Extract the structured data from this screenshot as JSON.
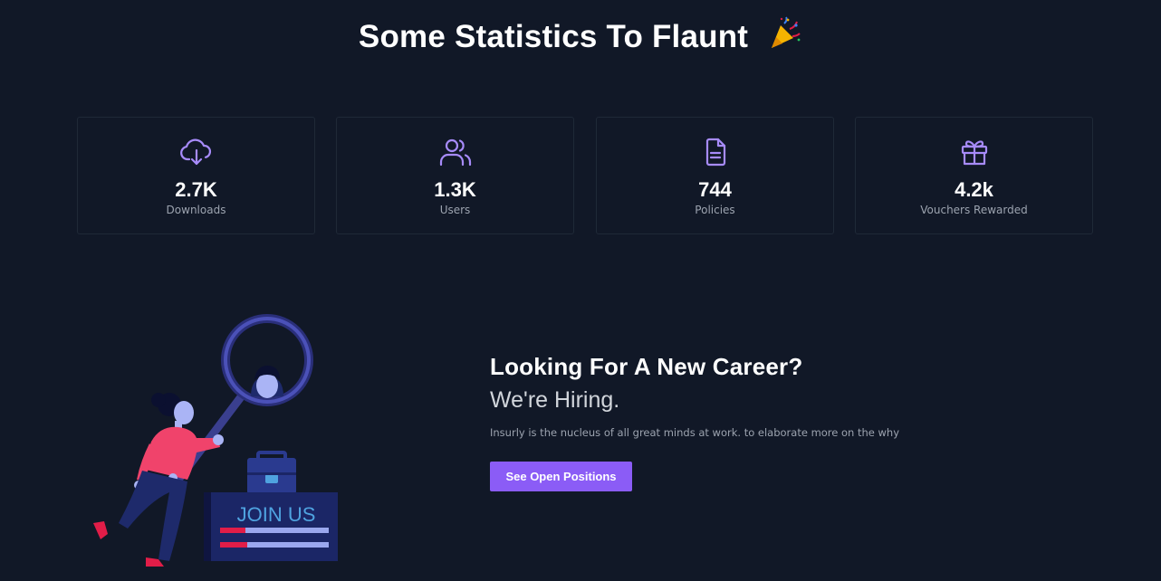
{
  "header": {
    "title": "Some Statistics To Flaunt",
    "emoji": "party-popper-icon"
  },
  "stats": [
    {
      "icon": "cloud-download-icon",
      "value": "2.7K",
      "label": "Downloads"
    },
    {
      "icon": "users-icon",
      "value": "1.3K",
      "label": "Users"
    },
    {
      "icon": "document-icon",
      "value": "744",
      "label": "Policies"
    },
    {
      "icon": "gift-icon",
      "value": "4.2k",
      "label": "Vouchers Rewarded"
    }
  ],
  "career": {
    "heading": "Looking For A New Career?",
    "subheading": "We're Hiring.",
    "description": "Insurly is the nucleus of all great minds at work. to elaborate more on the why",
    "button_label": "See Open Positions",
    "illustration_sign": "JOIN US"
  },
  "colors": {
    "background": "#111827",
    "accent": "#8b5cf6",
    "card_border": "#1f2937"
  }
}
